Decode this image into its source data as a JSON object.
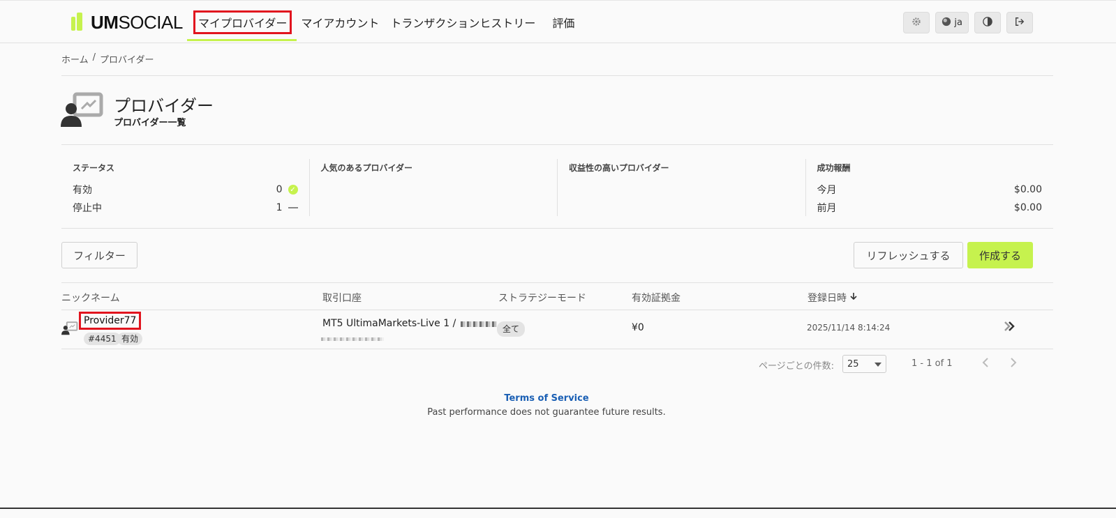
{
  "brand": {
    "bold": "UM",
    "light": "SOCIAL"
  },
  "nav": {
    "items": [
      {
        "label": "マイプロバイダー"
      },
      {
        "label": "マイアカウント"
      },
      {
        "label": "トランザクションヒストリー"
      },
      {
        "label": "評価"
      }
    ],
    "lang": "ja"
  },
  "breadcrumb": {
    "home": "ホーム",
    "sep": "/",
    "current": "プロバイダー"
  },
  "header": {
    "title": "プロバイダー",
    "subtitle": "プロバイダー一覧"
  },
  "stats": {
    "status": {
      "heading": "ステータス",
      "active_label": "有効",
      "active_count": "0",
      "stopped_label": "停止中",
      "stopped_count": "1"
    },
    "popular": {
      "heading": "人気のあるプロバイダー"
    },
    "profitable": {
      "heading": "収益性の高いプロバイダー"
    },
    "reward": {
      "heading": "成功報酬",
      "this_month_label": "今月",
      "this_month_value": "$0.00",
      "last_month_label": "前月",
      "last_month_value": "$0.00"
    }
  },
  "actions": {
    "filter": "フィルター",
    "refresh": "リフレッシュする",
    "create": "作成する"
  },
  "table": {
    "columns": {
      "nickname": "ニックネーム",
      "account": "取引口座",
      "strategy": "ストラテジーモード",
      "margin": "有効証拠金",
      "registered": "登録日時"
    },
    "rows": [
      {
        "nickname": "Provider77",
        "id": "#4451",
        "status": "有効",
        "account": "MT5 UltimaMarkets-Live 1 /",
        "strategy": "全て",
        "margin": "¥0",
        "registered": "2025/11/14 8:14:24"
      }
    ]
  },
  "pagination": {
    "per_page_label": "ページごとの件数:",
    "per_page": "25",
    "range": "1 - 1 of 1"
  },
  "footer": {
    "tos": "Terms of Service",
    "disclaimer": "Past performance does not guarantee future results."
  },
  "colors": {
    "accent": "#c6f24e",
    "highlight": "#e1141e",
    "link": "#1a5fb4"
  }
}
